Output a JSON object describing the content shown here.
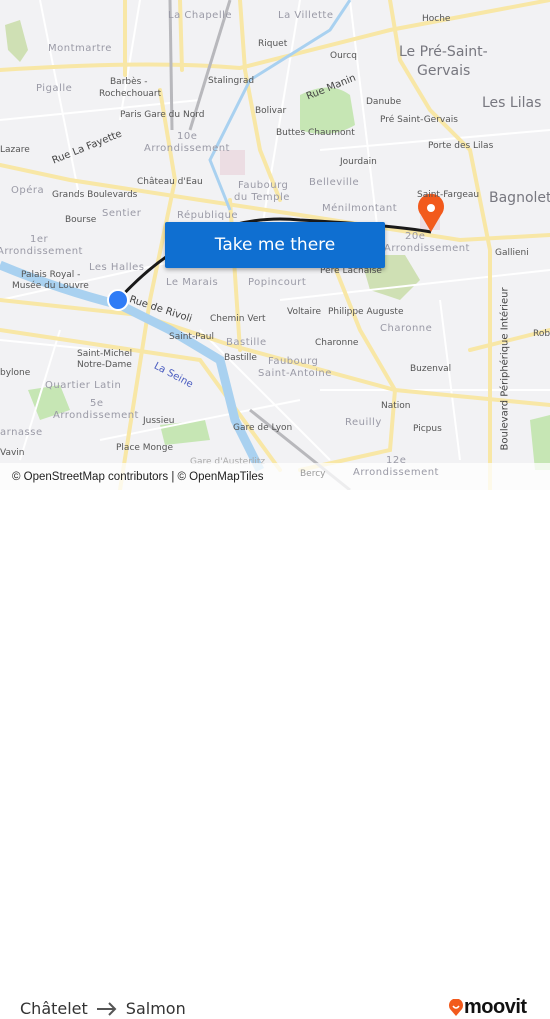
{
  "map": {
    "labels": [
      "Montmartre",
      "La Chapelle",
      "La Villette",
      "Riquet",
      "Hoche",
      "Ourcq",
      "Le Pré-Saint-",
      "Gervais",
      "Pigalle",
      "Barbès -",
      "Rochechouart",
      "Stalingrad",
      "Rue Manin",
      "Danube",
      "Les Lilas",
      "Bolivar",
      "Paris Gare du Nord",
      "Pré Saint-Gervais",
      "Buttes Chaumont",
      "10e",
      "Arrondissement",
      "Rue La Fayette",
      "Porte des Lilas",
      "Jourdain",
      "Château d'Eau",
      "Faubourg",
      "du Temple",
      "Belleville",
      "Opéra",
      "Grands Boulevards",
      "Saint-Fargeau",
      "Bagnolet",
      "Sentier",
      "Bourse",
      "République",
      "Ménilmontant",
      "1er",
      "Arrondissement",
      "20e",
      "Arrondissement",
      "Les Halles",
      "Palais Royal -",
      "Musée du Louvre",
      "Le Marais",
      "Popincourt",
      "Père Lachaise",
      "Gallieni",
      "Rue de Rivoli",
      "Chemin Vert",
      "Voltaire",
      "Philippe Auguste",
      "Charonne",
      "Rob",
      "Saint-Paul",
      "Bastille",
      "Bastille",
      "Charonne",
      "Faubourg",
      "Saint-Antoine",
      "Saint-Michel",
      "Notre-Dame",
      "La Seine",
      "Buzenval",
      "bylone",
      "Quartier Latin",
      "5e",
      "Arrondissement",
      "Nation",
      "Reuilly",
      "Picpus",
      "Jussieu",
      "Gare de Lyon",
      "Place Monge",
      "12e",
      "Arrondissement",
      "Boulevard Périphérique Intérieur",
      "arnasse",
      "Gare d'Austerlitz",
      "Bercy",
      "Lazare",
      "Vavin"
    ],
    "cta_label": "Take me there",
    "attribution": "© OpenStreetMap contributors | © OpenMapTiles",
    "origin_color": "#2f7cf6",
    "destination_color": "#f25a1c",
    "route_color": "#1a1a1a"
  },
  "footer": {
    "origin": "Châtelet",
    "destination": "Salmon",
    "arrow_icon": "arrow-right-icon",
    "brand": "moovit",
    "brand_color": "#f25a1c"
  }
}
